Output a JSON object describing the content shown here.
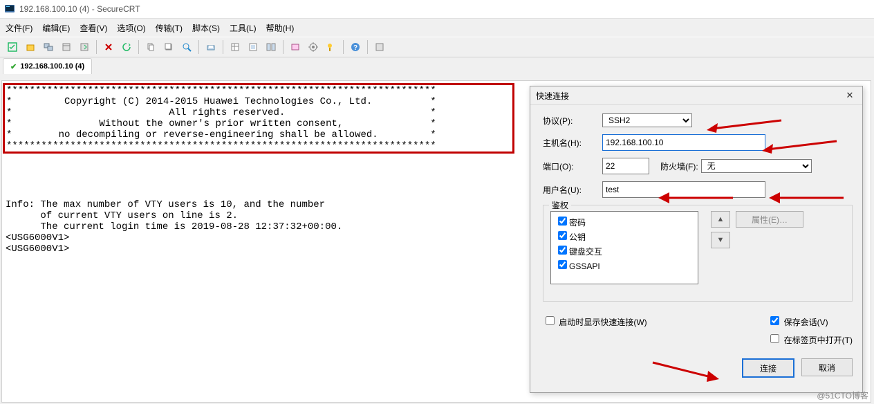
{
  "title": "192.168.100.10 (4) - SecureCRT",
  "menu": {
    "file": "文件(F)",
    "edit": "编辑(E)",
    "view": "查看(V)",
    "options": "选项(O)",
    "transfer": "传输(T)",
    "script": "脚本(S)",
    "tools": "工具(L)",
    "help": "帮助(H)"
  },
  "tab": {
    "label": "192.168.100.10 (4)"
  },
  "banner": "**************************************************************************\n*         Copyright (C) 2014-2015 Huawei Technologies Co., Ltd.          *\n*                           All rights reserved.                         *\n*               Without the owner's prior written consent,               *\n*        no decompiling or reverse-engineering shall be allowed.         *\n**************************************************************************",
  "info": "\n\nInfo: The max number of VTY users is 10, and the number\n      of current VTY users on line is 2.\n      The current login time is 2019-08-28 12:37:32+00:00.\n<USG6000V1>\n<USG6000V1>",
  "dialog": {
    "title": "快速连接",
    "protocol_label": "协议(P):",
    "protocol_value": "SSH2",
    "host_label": "主机名(H):",
    "host_value": "192.168.100.10",
    "port_label": "端口(O):",
    "port_value": "22",
    "firewall_label": "防火墙(F):",
    "firewall_value": "无",
    "user_label": "用户名(U):",
    "user_value": "test",
    "auth_legend": "鉴权",
    "auth": {
      "pwd": "密码",
      "pub": "公钥",
      "kbd": "键盘交互",
      "gss": "GSSAPI"
    },
    "properties_btn": "属性(E)…",
    "startup_label": "启动时显示快速连接(W)",
    "save_label": "保存会话(V)",
    "opentab_label": "在标签页中打开(T)",
    "connect": "连接",
    "cancel": "取消"
  },
  "watermark": "@51CTO博客"
}
